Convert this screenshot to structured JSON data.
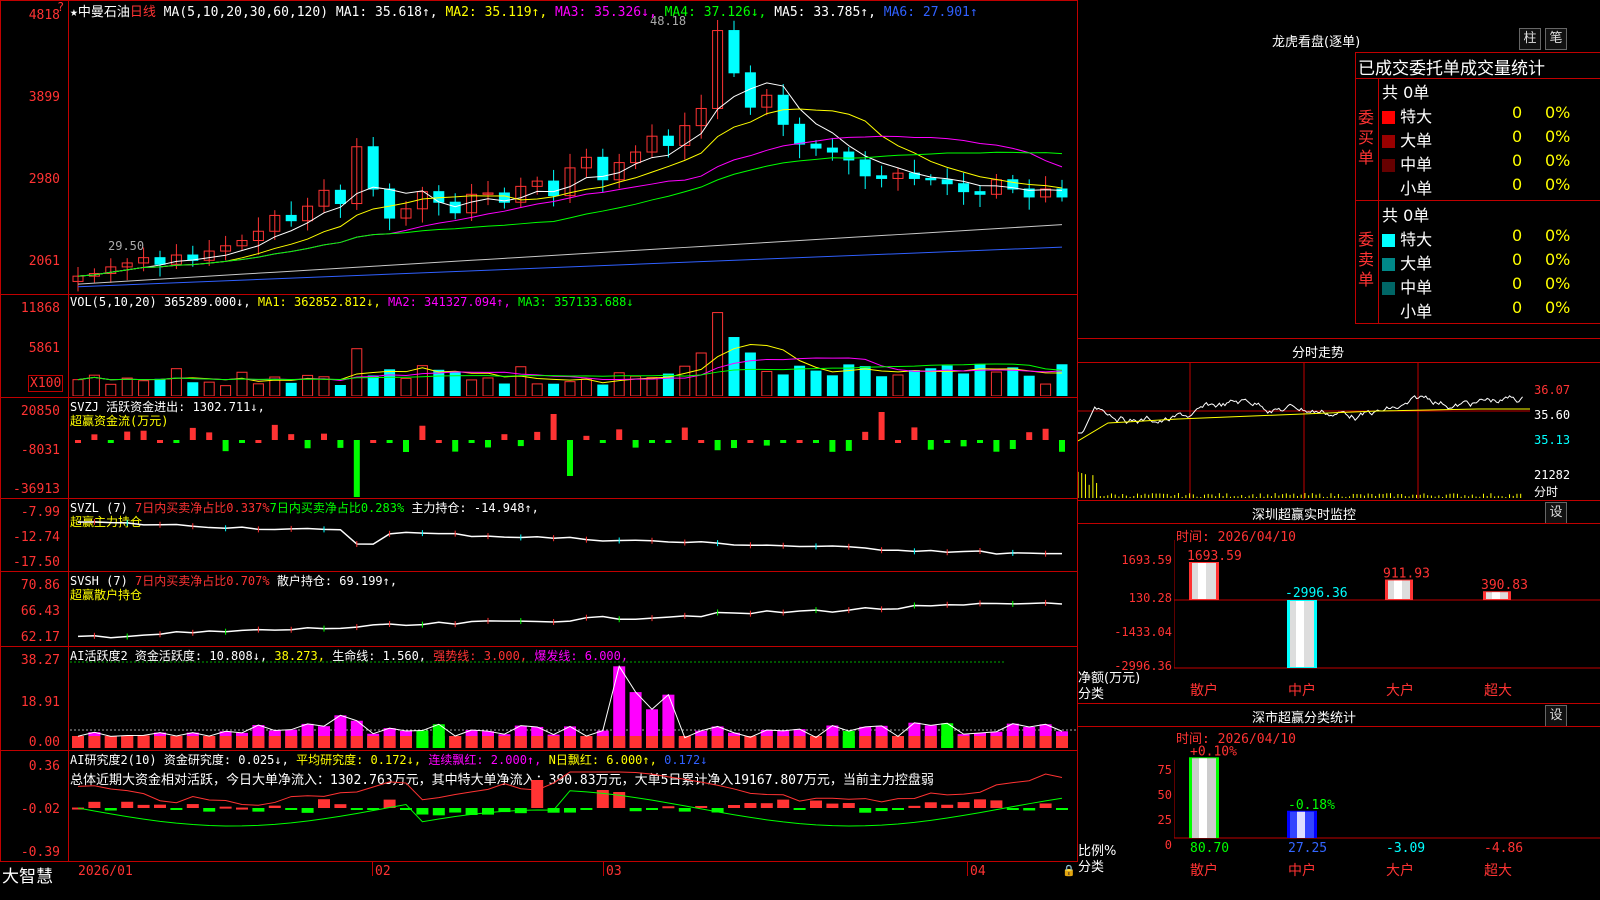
{
  "colors": {
    "up": "#ff3333",
    "down": "#00ffff",
    "grid": "#c00000",
    "ma1": "#ffffff",
    "ma2": "#ffff00",
    "ma3": "#ff00ff",
    "ma4": "#00ff00",
    "ma5": "#c8c8c8",
    "ma6": "#3060ff"
  },
  "main": {
    "title": "★中曼石油",
    "period": "日线",
    "ma_label": "MA(5,10,20,30,60,120)",
    "ma1": "MA1: 35.618↑,",
    "ma2": "MA2: 35.119↑,",
    "ma3": "MA3: 35.326↓,",
    "ma4": "MA4: 37.126↓,",
    "ma5": "MA5: 33.785↑,",
    "ma6": "MA6: 27.901↑",
    "yticks": [
      "4818",
      "3899",
      "2980",
      "2061"
    ],
    "corner": "?",
    "hi_label": "48.18",
    "lo_label": "29.50"
  },
  "vol": {
    "label": "VOL(5,10,20)",
    "value": "365289.000↓,",
    "ma1": "MA1: 362852.812↓,",
    "ma2": "MA2: 341327.094↑,",
    "ma3": "MA3: 357133.688↓",
    "yticks": [
      "11868",
      "5861"
    ],
    "unit": "X100"
  },
  "svzj": {
    "label": "SVZJ  活跃资金进出: 1302.711↓,",
    "sub": "超赢资金流(万元)",
    "yticks": [
      "20850",
      "-8031",
      "-36913"
    ]
  },
  "svzl": {
    "label": "SVZL (7)",
    "pct": "7日内买卖净占比0.337%",
    "pct2": "7日内买卖净占比0.283%",
    "hold": "主力持仓: -14.948↑,",
    "sub": "超赢主力持仓",
    "yticks": [
      "-7.99",
      "-12.74",
      "-17.50"
    ]
  },
  "svsh": {
    "label": "SVSH (7)",
    "pct": "7日内买卖净占比0.707%",
    "hold": "散户持仓: 69.199↑,",
    "sub": "超赢散户持仓",
    "yticks": [
      "70.86",
      "66.43",
      "62.17"
    ]
  },
  "ai2": {
    "label": "AI活跃度2",
    "v1": "资金活跃度: 10.808↓,",
    "v2": "38.273,",
    "v3": "生命线: 1.560,",
    "v4": "强势线: 3.000,",
    "v5": "爆发线: 6.000,",
    "yticks": [
      "38.27",
      "18.91",
      "0.00"
    ]
  },
  "ai3": {
    "label": "AI研究度2(10)",
    "v1": "资金研究度: 0.025↓,",
    "v2": "平均研究度: 0.172↓,",
    "v3": "连续飘红: 2.000↑,",
    "v4": "N日飘红: 6.000↑,",
    "v5": "0.172↓",
    "summary": "总体近期大资金相对活跃，今日大单净流入：1302.763万元，其中特大单净流入：390.83万元，大单5日累计净入19167.807万元，当前主力控盘弱",
    "yticks": [
      "0.36",
      "-0.02",
      "-0.39"
    ]
  },
  "xaxis": {
    "brand": "大智慧",
    "labels": [
      "2026/01",
      "02",
      "03",
      "04"
    ]
  },
  "panel1": {
    "title": "龙虎看盘(逐单)",
    "btn1": "柱",
    "btn2": "笔",
    "subtitle": "已成交委托单成交量统计",
    "buy": {
      "side": "委买单",
      "total": "共 0单",
      "rows": [
        {
          "name": "特大",
          "v": "0",
          "p": "0%",
          "color": "#ff0000"
        },
        {
          "name": "大单",
          "v": "0",
          "p": "0%",
          "color": "#990000"
        },
        {
          "name": "中单",
          "v": "0",
          "p": "0%",
          "color": "#660000"
        },
        {
          "name": "小单",
          "v": "0",
          "p": "0%",
          "color": ""
        }
      ]
    },
    "sell": {
      "side": "委卖单",
      "total": "共 0单",
      "rows": [
        {
          "name": "特大",
          "v": "0",
          "p": "0%",
          "color": "#00ffff"
        },
        {
          "name": "大单",
          "v": "0",
          "p": "0%",
          "color": "#008888"
        },
        {
          "name": "中单",
          "v": "0",
          "p": "0%",
          "color": "#006666"
        },
        {
          "name": "小单",
          "v": "0",
          "p": "0%",
          "color": ""
        }
      ]
    }
  },
  "panel2": {
    "title": "分时走势",
    "p1": "36.07",
    "p2": "35.60",
    "p3": "35.13",
    "vol": "21282",
    "unit": "分时"
  },
  "panel3": {
    "title": "深圳超赢实时监控",
    "btn": "设",
    "time": "时间: 2026/04/10",
    "yticks": [
      "1693.59",
      "130.28",
      "-1433.04",
      "-2996.36"
    ],
    "ylabel": "净额(万元)",
    "xlabel": "分类",
    "cats": [
      "散户",
      "中户",
      "大户",
      "超大"
    ],
    "values": [
      1693.59,
      -2996.36,
      911.93,
      390.83
    ],
    "value_labels": [
      "1693.59",
      "-2996.36",
      "911.93",
      "390.83"
    ]
  },
  "panel4": {
    "title": "深市超赢分类统计",
    "btn": "设",
    "time": "时间: 2026/04/10",
    "yticks": [
      "75",
      "50",
      "25",
      "0"
    ],
    "ylabel": "比例%",
    "xlabel": "分类",
    "cats": [
      "散户",
      "中户",
      "大户",
      "超大"
    ],
    "top_labels": [
      "+0.10%",
      "-0.18%"
    ],
    "values": [
      80.7,
      27.25,
      -3.09,
      -4.86
    ],
    "value_labels": [
      "80.70",
      "27.25",
      "-3.09",
      "-4.86"
    ]
  }
}
